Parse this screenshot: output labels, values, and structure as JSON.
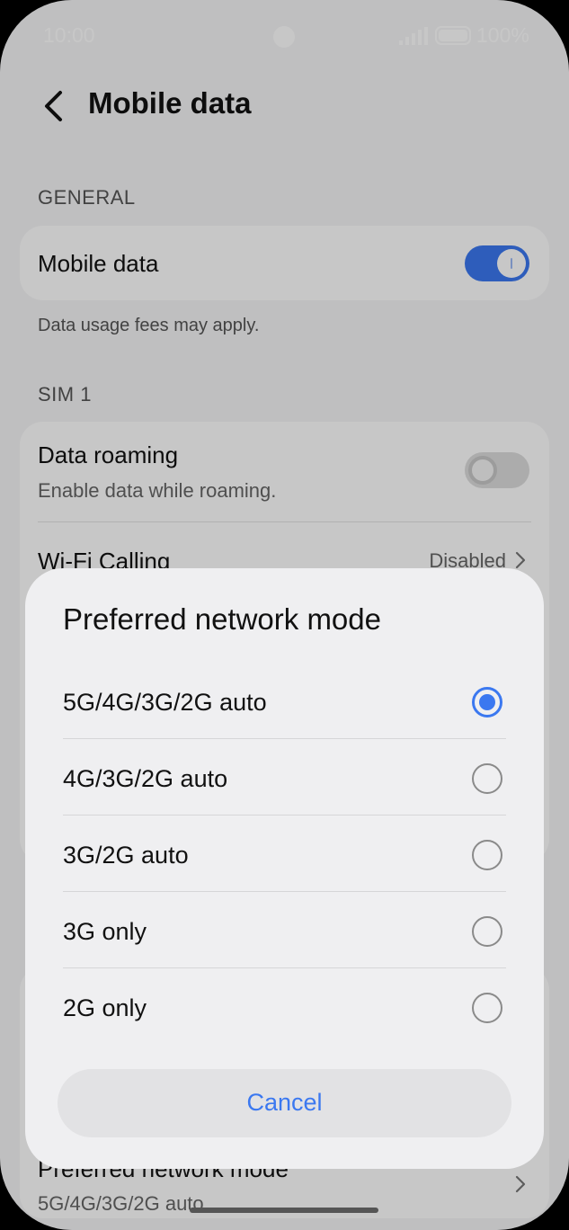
{
  "status_bar": {
    "time": "10:00",
    "battery": "100%"
  },
  "header": {
    "title": "Mobile data"
  },
  "sections": {
    "general": {
      "label": "GENERAL",
      "mobile_data": {
        "title": "Mobile data",
        "toggle": "on"
      },
      "helper": "Data usage fees may apply."
    },
    "sim1": {
      "label": "SIM 1",
      "data_roaming": {
        "title": "Data roaming",
        "subtitle": "Enable data while roaming.",
        "toggle": "off"
      },
      "wifi_calling": {
        "title": "Wi-Fi Calling",
        "value": "Disabled"
      }
    },
    "network_mode_row": {
      "title": "Preferred network mode",
      "value": "5G/4G/3G/2G auto"
    }
  },
  "dialog": {
    "title": "Preferred network mode",
    "options": [
      {
        "label": "5G/4G/3G/2G auto",
        "selected": true
      },
      {
        "label": "4G/3G/2G auto",
        "selected": false
      },
      {
        "label": "3G/2G auto",
        "selected": false
      },
      {
        "label": "3G only",
        "selected": false
      },
      {
        "label": "2G only",
        "selected": false
      }
    ],
    "cancel_label": "Cancel"
  },
  "colors": {
    "accent": "#3b78f0",
    "scrim": "rgba(0,0,0,0.22)",
    "dialog_bg": "#efeff1"
  },
  "icons": {
    "back": "chevron-left-icon",
    "chevron": "chevron-right-icon",
    "signal": "signal-icon",
    "battery": "battery-icon"
  }
}
